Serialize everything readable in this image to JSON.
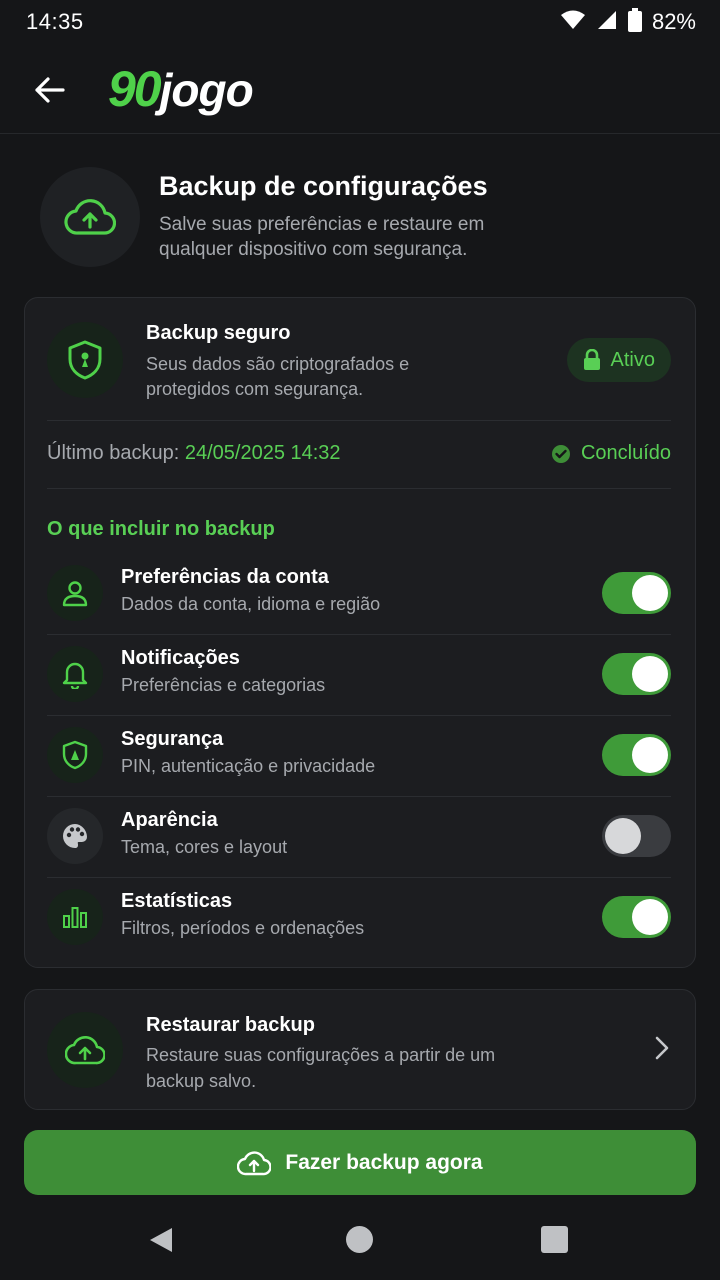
{
  "status_bar": {
    "time": "14:35",
    "battery": "82%"
  },
  "app_bar": {
    "logo_number": "90",
    "logo_word": "jogo"
  },
  "header": {
    "title": "Backup de configurações",
    "subtitle": "Salve suas preferências e restaure em qualquer dispositivo com segurança."
  },
  "secure": {
    "title": "Backup seguro",
    "description": "Seus dados são criptografados e protegidos com segurança.",
    "badge": "Ativo"
  },
  "last_backup": {
    "label": "Último backup:",
    "date": "24/05/2025 14:32",
    "status": "Concluído"
  },
  "options_section": {
    "title": "O que incluir no backup",
    "items": [
      {
        "title": "Preferências da conta",
        "description": "Dados da conta, idioma e região",
        "icon": "person-icon",
        "enabled": true
      },
      {
        "title": "Notificações",
        "description": "Preferências e categorias",
        "icon": "bell-icon",
        "enabled": true
      },
      {
        "title": "Segurança",
        "description": "PIN, autenticação e privacidade",
        "icon": "shield-icon",
        "enabled": true
      },
      {
        "title": "Aparência",
        "description": "Tema, cores e layout",
        "icon": "palette-icon",
        "enabled": false
      },
      {
        "title": "Estatísticas",
        "description": "Filtros, períodos e ordenações",
        "icon": "bar-chart-icon",
        "enabled": true
      }
    ]
  },
  "restore": {
    "title": "Restaurar backup",
    "description": "Restaure suas configurações a partir de um backup salvo."
  },
  "primary_button": {
    "label": "Fazer backup agora"
  },
  "colors": {
    "accent": "#59cf55",
    "button": "#3e8e37",
    "background": "#151618",
    "card": "#1c1d20"
  }
}
